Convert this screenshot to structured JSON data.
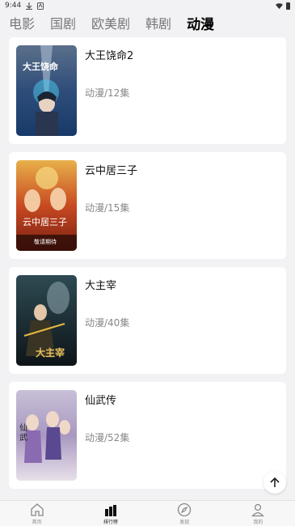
{
  "status_bar": {
    "time": "9:44"
  },
  "tabs": [
    {
      "label": "电影"
    },
    {
      "label": "国剧"
    },
    {
      "label": "欧美剧"
    },
    {
      "label": "韩剧"
    },
    {
      "label": "动漫"
    }
  ],
  "active_tab": "动漫",
  "items": [
    {
      "title": "大王饶命2",
      "meta": "动漫/12集"
    },
    {
      "title": "云中居三子",
      "meta": "动漫/15集"
    },
    {
      "title": "大主宰",
      "meta": "动漫/40集"
    },
    {
      "title": "仙武传",
      "meta": "动漫/52集"
    }
  ],
  "bottom_nav": [
    {
      "label": "首页",
      "icon": "home-icon"
    },
    {
      "label": "排行榜",
      "icon": "ranking-icon"
    },
    {
      "label": "发现",
      "icon": "compass-icon"
    },
    {
      "label": "我的",
      "icon": "profile-icon"
    }
  ],
  "active_nav": "排行榜",
  "back_to_top": {
    "icon": "arrow-up-icon"
  }
}
